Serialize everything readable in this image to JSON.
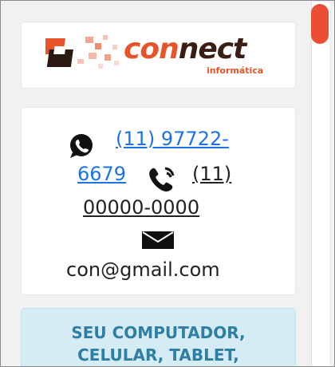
{
  "logo": {
    "word_main": "con",
    "word_accent": "nect",
    "tagline": "informática",
    "alt_icon": "connect-logo-mark"
  },
  "contact": {
    "whatsapp_icon": "whatsapp-icon",
    "whatsapp_number_part1": "(11) 97722-",
    "whatsapp_number_part2": "6679",
    "phone_icon": "phone-ringing-icon",
    "phone_number_part1": "(11)",
    "phone_number_part2": "00000-0000",
    "email_icon": "envelope-icon",
    "email": "con@gmail.com"
  },
  "promo": {
    "line1": "SEU COMPUTADOR,",
    "line2": "CELULAR, TABLET,"
  },
  "colors": {
    "brand_orange": "#e8532a",
    "link_blue": "#1a73e8",
    "promo_text": "#2f7ea6",
    "promo_bg": "#d6ecf5",
    "scroll_thumb": "#ec4d35"
  }
}
